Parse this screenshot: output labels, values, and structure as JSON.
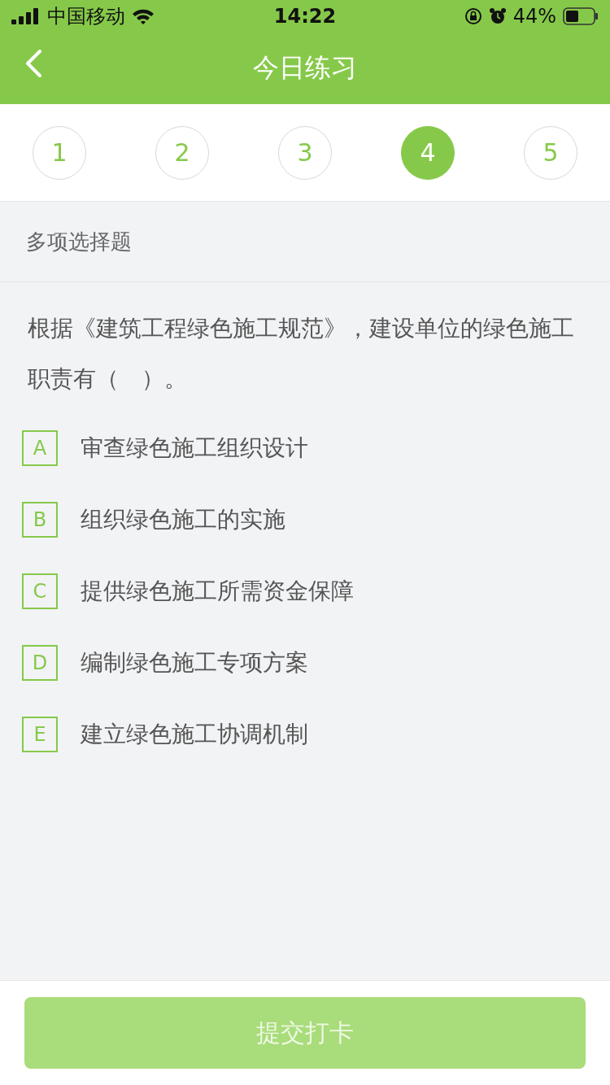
{
  "status_bar": {
    "carrier": "中国移动",
    "time": "14:22",
    "battery": "44%"
  },
  "nav": {
    "title": "今日练习"
  },
  "question_tabs": [
    {
      "label": "1",
      "selected": false
    },
    {
      "label": "2",
      "selected": false
    },
    {
      "label": "3",
      "selected": false
    },
    {
      "label": "4",
      "selected": true
    },
    {
      "label": "5",
      "selected": false
    }
  ],
  "question_type": "多项选择题",
  "question": "根据《建筑工程绿色施工规范》，建设单位的绿色施工职责有（　）。",
  "options": [
    {
      "letter": "A",
      "text": "审查绿色施工组织设计",
      "selected": false
    },
    {
      "letter": "B",
      "text": "组织绿色施工的实施",
      "selected": false
    },
    {
      "letter": "C",
      "text": "提供绿色施工所需资金保障",
      "selected": false
    },
    {
      "letter": "D",
      "text": "编制绿色施工专项方案",
      "selected": false
    },
    {
      "letter": "E",
      "text": "建立绿色施工协调机制",
      "selected": false
    }
  ],
  "submit": {
    "label": "提交打卡",
    "disabled": true
  }
}
